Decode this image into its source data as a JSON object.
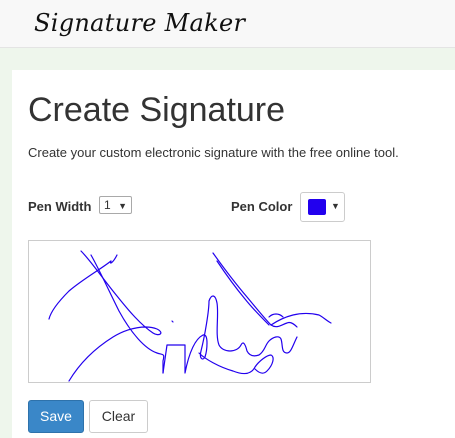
{
  "brand": "Signature Maker",
  "page": {
    "title": "Create Signature",
    "subtitle": "Create your custom electronic signature with the free online tool."
  },
  "controls": {
    "pen_width_label": "Pen Width",
    "pen_width_value": "1",
    "pen_color_label": "Pen Color",
    "pen_color_value": "#2200ee",
    "caret_icon": "chevron-down-icon"
  },
  "actions": {
    "save_label": "Save",
    "clear_label": "Clear"
  }
}
